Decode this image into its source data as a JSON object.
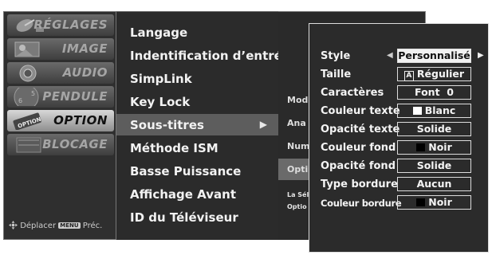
{
  "category_menu": {
    "items": [
      {
        "label": "RÉGLAGES",
        "icon": "satellite-dish-icon",
        "selected": false
      },
      {
        "label": "IMAGE",
        "icon": "picture-icon",
        "selected": false
      },
      {
        "label": "AUDIO",
        "icon": "speaker-icon",
        "selected": false
      },
      {
        "label": "PENDULE",
        "icon": "clock-icon",
        "selected": false
      },
      {
        "label": "OPTION",
        "icon": "option-icon",
        "selected": true
      },
      {
        "label": "BLOCAGE",
        "icon": "lock-icon",
        "selected": false
      }
    ],
    "footer": {
      "move_label": "Déplacer",
      "menu_key": "MENU",
      "back_label": "Préc."
    }
  },
  "option_menu": {
    "items": [
      {
        "label": "Langage",
        "selected": false
      },
      {
        "label": "Indentification d’entrée",
        "selected": false
      },
      {
        "label": "SimpLink",
        "selected": false
      },
      {
        "label": "Key Lock",
        "selected": false
      },
      {
        "label": "Sous-titres",
        "selected": true,
        "arrow": "▶"
      },
      {
        "label": "Méthode ISM",
        "selected": false
      },
      {
        "label": "Basse Puissance",
        "selected": false
      },
      {
        "label": "Affichage Avant",
        "selected": false
      },
      {
        "label": "ID du Téléviseur",
        "selected": false
      }
    ]
  },
  "subtitle_submenu": {
    "items": [
      {
        "label": "Mod",
        "selected": false
      },
      {
        "label": "Ana",
        "selected": false
      },
      {
        "label": "Num",
        "selected": false
      },
      {
        "label": "Opti",
        "selected": true
      }
    ],
    "description_lines": [
      "La Sél",
      "Optio"
    ]
  },
  "subtitle_settings": {
    "rows": [
      {
        "label": "Style",
        "value": "Personnalisé",
        "active": true,
        "left_arrow": "◀",
        "right_arrow": "▶"
      },
      {
        "label": "Taille",
        "value": "Régulier",
        "value_icon": "A"
      },
      {
        "label": "Caractères",
        "value": "Font  0"
      },
      {
        "label": "Couleur texte",
        "value": "Blanc",
        "swatch": "#ffffff"
      },
      {
        "label": "Opacité texte",
        "value": "Solide"
      },
      {
        "label": "Couleur fond",
        "value": "Noir",
        "swatch": "#000000"
      },
      {
        "label": "Opacité fond",
        "value": "Solide"
      },
      {
        "label": "Type bordure",
        "value": "Aucun"
      },
      {
        "label": "Couleur bordure",
        "value": "Noir",
        "swatch": "#000000"
      }
    ]
  }
}
